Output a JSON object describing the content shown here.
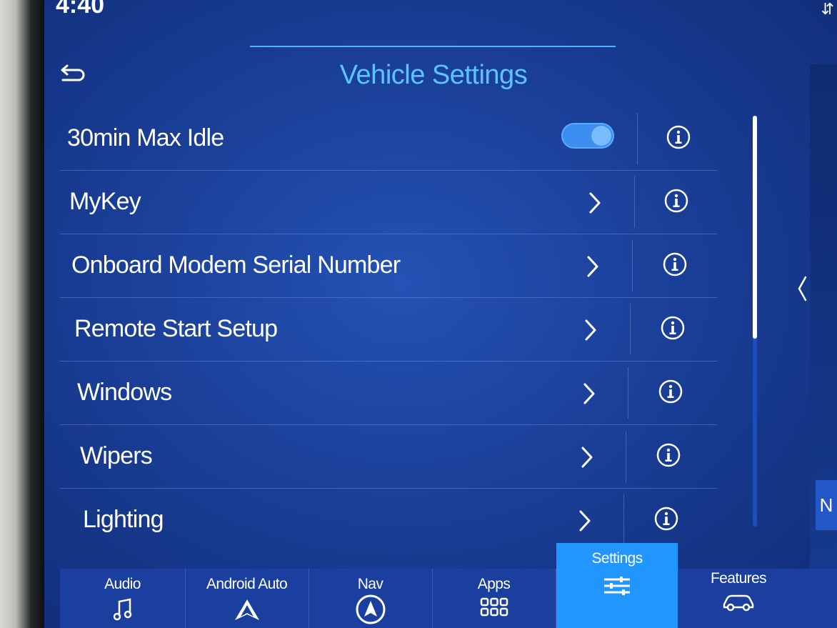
{
  "status": {
    "time": "4:40"
  },
  "header": {
    "title": "Vehicle Settings"
  },
  "settings": {
    "items": [
      {
        "label": "30min Max Idle",
        "type": "toggle",
        "toggle_on": true
      },
      {
        "label": "MyKey",
        "type": "link"
      },
      {
        "label": "Onboard Modem Serial Number",
        "type": "link"
      },
      {
        "label": "Remote Start Setup",
        "type": "link"
      },
      {
        "label": "Windows",
        "type": "link"
      },
      {
        "label": "Wipers",
        "type": "link"
      },
      {
        "label": "Lighting",
        "type": "link"
      }
    ]
  },
  "side_panel": {
    "label": "N"
  },
  "nav": {
    "tabs": [
      {
        "label": "Audio",
        "icon": "music-note-icon"
      },
      {
        "label": "Android Auto",
        "icon": "android-auto-icon"
      },
      {
        "label": "Nav",
        "icon": "compass-icon"
      },
      {
        "label": "Apps",
        "icon": "grid-icon"
      },
      {
        "label": "Settings",
        "icon": "sliders-icon",
        "active": true
      },
      {
        "label": "Features",
        "icon": "car-icon"
      }
    ]
  },
  "colors": {
    "accent": "#5cc3ff",
    "active_tab": "#2196ff",
    "toggle_on": "#3c8ef0",
    "background": "#1a3f98"
  }
}
